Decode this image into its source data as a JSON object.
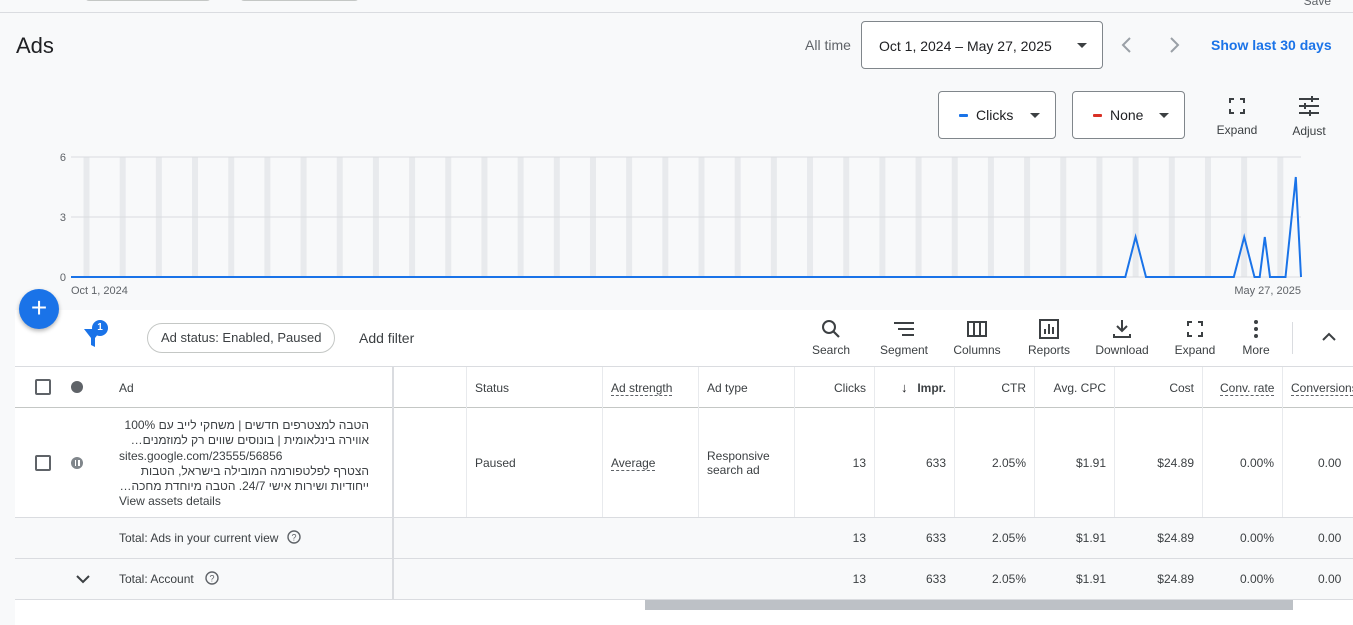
{
  "header": {
    "save_label": "Save",
    "title": "Ads",
    "all_time_label": "All time",
    "date_range": "Oct 1, 2024 – May 27, 2025",
    "show_last": "Show last 30 days"
  },
  "chart_controls": {
    "metric1": "Clicks",
    "metric1_color": "#1a73e8",
    "metric2": "None",
    "metric2_color": "#d93025",
    "expand_label": "Expand",
    "adjust_label": "Adjust"
  },
  "chart_data": {
    "type": "line",
    "x_start_label": "Oct 1, 2024",
    "x_end_label": "May 27, 2025",
    "y_ticks": [
      "6",
      "3",
      "0"
    ],
    "ylim": [
      0,
      6
    ],
    "grid": true,
    "series": [
      {
        "color": "#1a73e8",
        "points": [
          {
            "x": "2024-10-01",
            "y": 0
          },
          {
            "x": "2025-04-23",
            "y": 0
          },
          {
            "x": "2025-04-25",
            "y": 2
          },
          {
            "x": "2025-04-27",
            "y": 0
          },
          {
            "x": "2025-05-14",
            "y": 0
          },
          {
            "x": "2025-05-16",
            "y": 2
          },
          {
            "x": "2025-05-18",
            "y": 0
          },
          {
            "x": "2025-05-19",
            "y": 0
          },
          {
            "x": "2025-05-20",
            "y": 2
          },
          {
            "x": "2025-05-21",
            "y": 0
          },
          {
            "x": "2025-05-24",
            "y": 0
          },
          {
            "x": "2025-05-26",
            "y": 5
          },
          {
            "x": "2025-05-27",
            "y": 0
          }
        ]
      }
    ]
  },
  "filters": {
    "badge_count": "1",
    "chip": "Ad status: Enabled, Paused",
    "add_filter": "Add filter"
  },
  "toolbar": {
    "search": "Search",
    "segment": "Segment",
    "columns": "Columns",
    "reports": "Reports",
    "download": "Download",
    "expand": "Expand",
    "more": "More"
  },
  "table": {
    "headers": {
      "ad": "Ad",
      "status": "Status",
      "ad_strength": "Ad strength",
      "ad_type": "Ad type",
      "clicks": "Clicks",
      "impr": "Impr.",
      "ctr": "CTR",
      "avg_cpc": "Avg. CPC",
      "cost": "Cost",
      "conv_rate": "Conv. rate",
      "conversions": "Conversions"
    },
    "ad_row": {
      "headline1": "הטבה למצטרפים חדשים | משחקי לייב עם 100%",
      "headline2": "אווירה בינלאומית | בונוסים שווים רק למוזמנים…",
      "url": "sites.google.com/23555/56856",
      "desc1": "הצטרף לפלטפורמה המובילה בישראל, הטבות",
      "desc2": "ייחודיות ושירות אישי 24/7. הטבה מיוחדת מחכה…",
      "view_assets": "View assets details",
      "status": "Paused",
      "ad_strength": "Average",
      "ad_type_line1": "Responsive",
      "ad_type_line2": "search ad",
      "clicks": "13",
      "impr": "633",
      "ctr": "2.05%",
      "avg_cpc": "$1.91",
      "cost": "$24.89",
      "conv_rate": "0.00%",
      "conversions": "0.00"
    },
    "total_view": {
      "label": "Total: Ads in your current view",
      "clicks": "13",
      "impr": "633",
      "ctr": "2.05%",
      "avg_cpc": "$1.91",
      "cost": "$24.89",
      "conv_rate": "0.00%",
      "conversions": "0.00"
    },
    "total_account": {
      "label": "Total: Account",
      "clicks": "13",
      "impr": "633",
      "ctr": "2.05%",
      "avg_cpc": "$1.91",
      "cost": "$24.89",
      "conv_rate": "0.00%",
      "conversions": "0.00"
    }
  }
}
